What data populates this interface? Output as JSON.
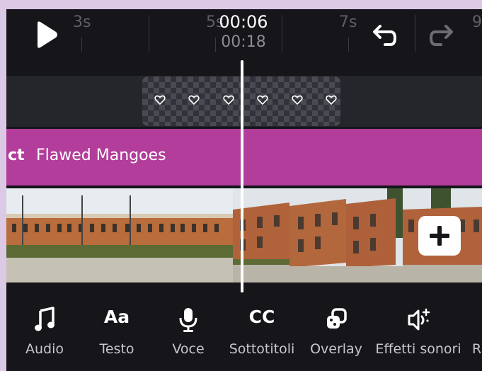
{
  "timeline": {
    "ticks": [
      "3s",
      "5s",
      "7s",
      "9"
    ],
    "current_time": "00:06",
    "total_time": "00:18"
  },
  "tracks": {
    "text_prefix": "ct",
    "text_title": "Flawed Mangoes"
  },
  "toolbar": {
    "items": [
      {
        "label": "Audio",
        "icon": "music-note-icon"
      },
      {
        "label": "Testo",
        "icon_text": "Aa"
      },
      {
        "label": "Voce",
        "icon": "microphone-icon"
      },
      {
        "label": "Sottotitoli",
        "icon_text": "CC"
      },
      {
        "label": "Overlay",
        "icon": "overlay-icon"
      },
      {
        "label": "Effetti sonori",
        "icon": "sound-effects-icon"
      },
      {
        "label": "R"
      }
    ]
  },
  "colors": {
    "text_track": "#b23d9a",
    "background": "#15151a",
    "accent_white": "#ffffff"
  }
}
